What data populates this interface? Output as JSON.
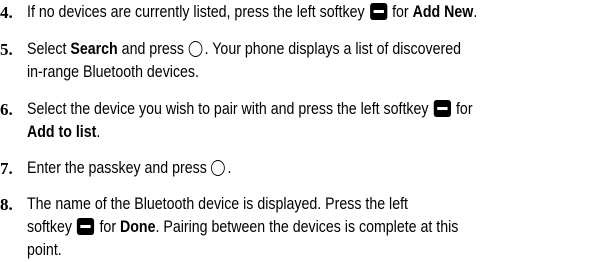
{
  "steps": [
    {
      "number": "4.",
      "lines": [
        {
          "t1": "If no devices are currently listed, press the left softkey",
          "t2": "for",
          "bold": "Add New",
          "t3": "."
        }
      ]
    },
    {
      "number": "5.",
      "lines": [
        {
          "t1": "Select",
          "bold": "Search",
          "t2": "and press",
          "t3": ". Your phone displays a list of discovered"
        },
        {
          "t1": "in-range Bluetooth devices."
        }
      ]
    },
    {
      "number": "6.",
      "lines": [
        {
          "t1": "Select the device you wish to pair with and press the left softkey",
          "t2": "for"
        },
        {
          "bold": "Add to list",
          "t1": "."
        }
      ]
    },
    {
      "number": "7.",
      "lines": [
        {
          "t1": "Enter the passkey and press",
          "t2": "."
        }
      ]
    },
    {
      "number": "8.",
      "lines": [
        {
          "t1": "The name of the Bluetooth device is displayed. Press the left"
        },
        {
          "t1": "softkey",
          "t2": "for",
          "bold": "Done",
          "t3": ". Pairing between the devices is complete at this"
        },
        {
          "t1": "point."
        }
      ]
    }
  ],
  "icons": {
    "left_softkey": "left-softkey-icon",
    "ok_key": "ok-key-icon"
  }
}
